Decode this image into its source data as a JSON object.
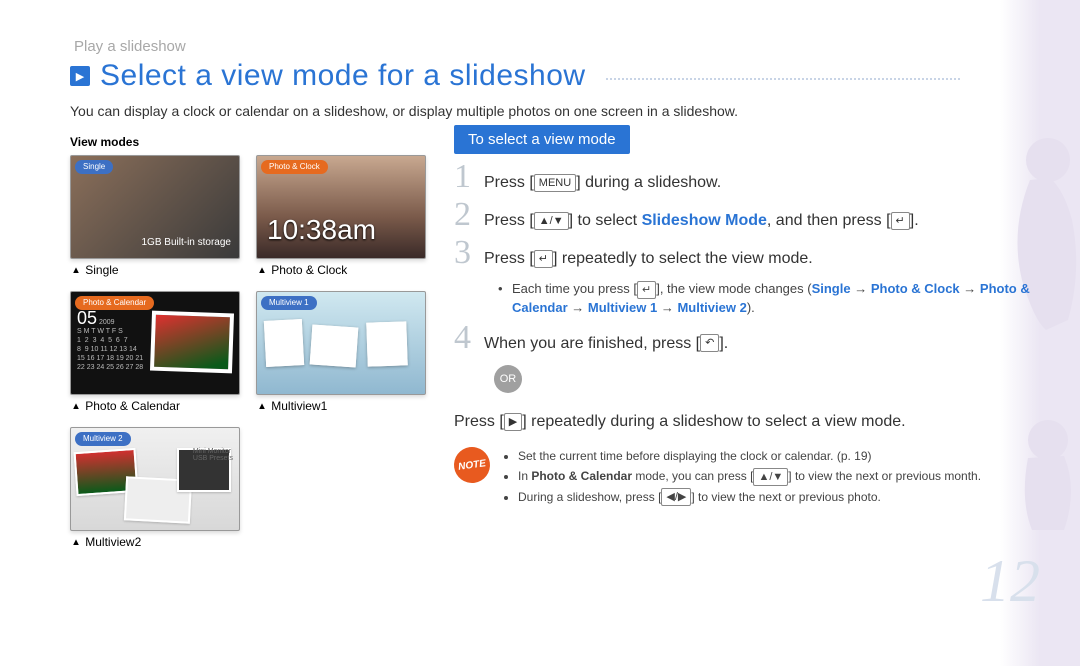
{
  "breadcrumb": "Play a slideshow",
  "title": "Select a view mode for a slideshow",
  "intro": "You can display a clock or calendar on a slideshow, or display multiple photos on one screen in a slideshow.",
  "viewmodes_label": "View modes",
  "thumbs": {
    "single": {
      "caption": "Single",
      "storage": "1GB Built-in storage"
    },
    "photo_clock": {
      "caption": "Photo & Clock",
      "clock": "10:38am"
    },
    "photo_calendar": {
      "caption": "Photo & Calendar",
      "month": "05",
      "year": "2009",
      "days": "S M T W T F S"
    },
    "multiview1": {
      "caption": "Multiview1"
    },
    "multiview2": {
      "caption": "Multiview2",
      "side1": "Mini Monitor",
      "side2": "USB Presets"
    }
  },
  "section_title": "To select a view mode",
  "steps": {
    "s1": {
      "num": "1",
      "pre": "Press ",
      "btn": "MENU",
      "post": " during a slideshow."
    },
    "s2": {
      "num": "2",
      "pre": "Press [",
      "btn_a": "▲/▼",
      "mid": "] to select ",
      "link": "Slideshow Mode",
      "post": ", and then press [",
      "btn_b": "↵",
      "end": "]."
    },
    "s3": {
      "num": "3",
      "pre": "Press [",
      "btn": "↵",
      "post": "] repeatedly to select the view mode."
    },
    "s3_sub_pre": "Each time you press [",
    "s3_sub_btn": "↵",
    "s3_sub_mid": "], the view mode changes (",
    "s3_seq_1": "Single",
    "s3_seq_2": "Photo & Clock",
    "s3_seq_3": "Photo & Calendar",
    "s3_seq_4": "Multiview 1",
    "s3_seq_5": "Multiview 2",
    "s4": {
      "num": "4",
      "pre": "When you are finished, press [",
      "btn": "↶",
      "post": "]."
    }
  },
  "or_label": "OR",
  "or_step": {
    "pre": "Press [",
    "btn": "▶",
    "post": "] repeatedly during a slideshow to select a view mode."
  },
  "notes": {
    "icon": "NOTE",
    "n1": "Set the current time before displaying the clock or calendar. (p. 19)",
    "n2_pre": "In ",
    "n2_b": "Photo & Calendar",
    "n2_mid": " mode, you can press [",
    "n2_btn": "▲/▼",
    "n2_post": "] to view the next or previous month.",
    "n3_pre": "During a slideshow, press [",
    "n3_btn": "◀/▶",
    "n3_post": "] to view the next or previous photo."
  },
  "page_number": "12"
}
